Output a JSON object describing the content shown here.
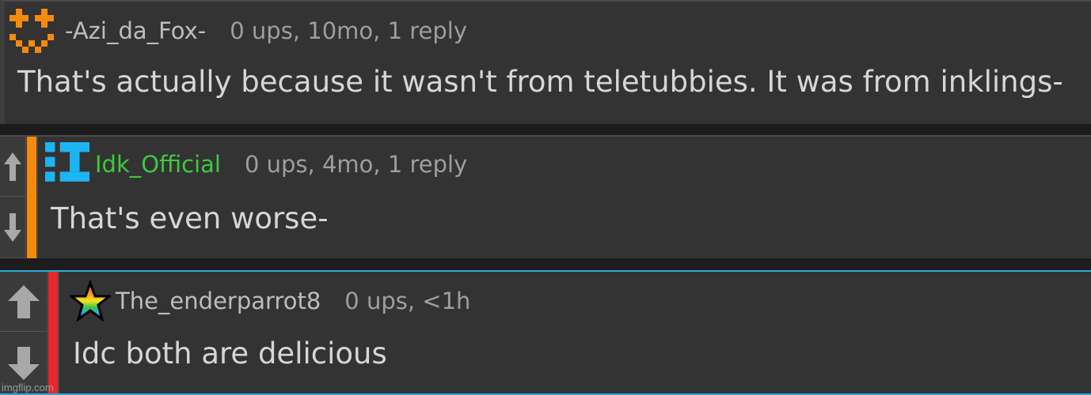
{
  "comments": [
    {
      "username": "-Azi_da_Fox-",
      "meta": "0 ups, 10mo, 1 reply",
      "body": "That's actually because it wasn't from teletubbies. It was from inklings-",
      "avatar_icon": "orange-pixel-face-icon",
      "avatar_color": "#f58a0d"
    },
    {
      "username": "Idk_Official",
      "meta": "0 ups, 4mo, 1 reply",
      "body": "That's even worse-",
      "avatar_icon": "blue-pixel-i-icon",
      "avatar_color": "#1db4f2",
      "username_color": "#3ec93e",
      "accent_color": "#f58a0d"
    },
    {
      "username": "The_enderparrot8",
      "meta": "0 ups, <1h",
      "body": "Idc both are delicious",
      "avatar_icon": "rainbow-star-icon",
      "accent_color": "#e8282c",
      "highlight_color": "#29a9d6"
    }
  ],
  "vote_icons": {
    "up": "arrow-up-icon",
    "down": "arrow-down-icon"
  },
  "watermark": "imgflip.com"
}
